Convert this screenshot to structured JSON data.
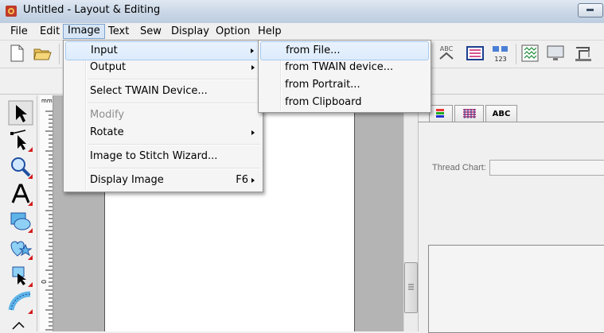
{
  "window": {
    "title": "Untitled - Layout & Editing"
  },
  "menubar": {
    "items": [
      "File",
      "Edit",
      "Image",
      "Text",
      "Sew",
      "Display",
      "Option",
      "Help"
    ],
    "active": "Image"
  },
  "image_menu": {
    "items": [
      {
        "label": "Input",
        "submenu": true,
        "state": "highlighted"
      },
      {
        "label": "Output",
        "submenu": true
      },
      {
        "label": "Select TWAIN Device..."
      },
      {
        "label": "Modify",
        "disabled": true
      },
      {
        "label": "Rotate",
        "submenu": true
      },
      {
        "label": "Image to Stitch Wizard..."
      },
      {
        "label": "Display Image",
        "shortcut": "F6",
        "submenu": true
      }
    ]
  },
  "input_submenu": {
    "items": [
      {
        "label": "from File...",
        "state": "hover"
      },
      {
        "label": "from TWAIN device..."
      },
      {
        "label": "from Portrait..."
      },
      {
        "label": "from Clipboard"
      }
    ]
  },
  "right_panel": {
    "tabs": [
      "thread-color-icon",
      "pattern-icon",
      "ABC"
    ],
    "thread_chart_label": "Thread Chart:",
    "thread_chart_value": ""
  },
  "ruler": {
    "unit": "mm",
    "marker": "0"
  },
  "toolbar_abc_label": "ABC",
  "toolbar_123_label": "123",
  "colors": {
    "menu_highlight": "#dcebfc",
    "title_bar": "#c8d5e5",
    "canvas_bg": "#b4b4b4",
    "page": "#ffffff"
  }
}
